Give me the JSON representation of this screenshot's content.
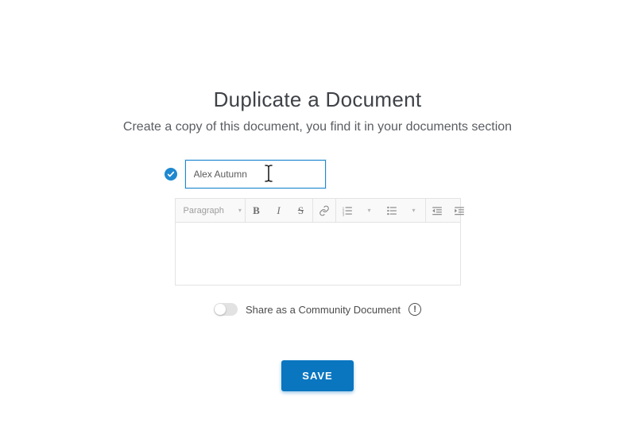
{
  "header": {
    "title": "Duplicate a Document",
    "subtitle": "Create a copy of this document, you find it in your documents section"
  },
  "form": {
    "title_value": "Alex Autumn",
    "title_placeholder": "",
    "block_select_label": "Paragraph"
  },
  "share": {
    "label": "Share as a Community Document",
    "enabled": false
  },
  "actions": {
    "save_label": "SAVE"
  }
}
